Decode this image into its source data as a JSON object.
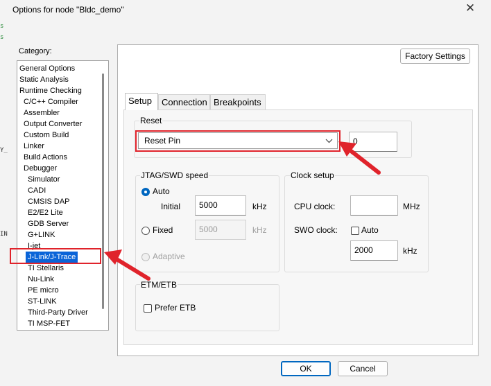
{
  "window": {
    "title": "Options for node \"Bldc_demo\"",
    "close_glyph": "✕"
  },
  "category": {
    "label": "Category:",
    "items": [
      {
        "label": "General Options"
      },
      {
        "label": "Static Analysis"
      },
      {
        "label": "Runtime Checking"
      },
      {
        "label": "C/C++ Compiler"
      },
      {
        "label": "Assembler"
      },
      {
        "label": "Output Converter"
      },
      {
        "label": "Custom Build"
      },
      {
        "label": "Linker"
      },
      {
        "label": "Build Actions"
      },
      {
        "label": "Debugger"
      },
      {
        "label": "Simulator"
      },
      {
        "label": "CADI"
      },
      {
        "label": "CMSIS DAP"
      },
      {
        "label": "E2/E2 Lite"
      },
      {
        "label": "GDB Server"
      },
      {
        "label": "G+LINK"
      },
      {
        "label": "I-jet"
      },
      {
        "label": "J-Link/J-Trace",
        "selected": true
      },
      {
        "label": "TI Stellaris"
      },
      {
        "label": "Nu-Link"
      },
      {
        "label": "PE micro"
      },
      {
        "label": "ST-LINK"
      },
      {
        "label": "Third-Party Driver"
      },
      {
        "label": "TI MSP-FET"
      }
    ]
  },
  "factory_settings_label": "Factory Settings",
  "tabs": [
    {
      "label": "Setup",
      "active": true
    },
    {
      "label": "Connection"
    },
    {
      "label": "Breakpoints"
    }
  ],
  "reset": {
    "group_label": "Reset",
    "selected": "Reset Pin",
    "delay_value": "0"
  },
  "jtag": {
    "group_label": "JTAG/SWD speed",
    "auto_label": "Auto",
    "initial_label": "Initial",
    "initial_value": "5000",
    "initial_unit": "kHz",
    "fixed_label": "Fixed",
    "fixed_value": "5000",
    "fixed_unit": "kHz",
    "adaptive_label": "Adaptive"
  },
  "clock": {
    "group_label": "Clock setup",
    "cpu_label": "CPU clock:",
    "cpu_value": "",
    "cpu_unit": "MHz",
    "swo_label": "SWO clock:",
    "swo_auto_label": "Auto",
    "swo_value": "2000",
    "swo_unit": "kHz"
  },
  "etm": {
    "group_label": "ETM/ETB",
    "prefer_label": "Prefer ETB"
  },
  "buttons": {
    "ok": "OK",
    "cancel": "Cancel"
  },
  "background_fragments": [
    "s",
    "s",
    "Y_",
    "IN"
  ],
  "colors": {
    "highlight_box": "#e0232b",
    "selection": "#0a64d8",
    "accent": "#0067c0"
  }
}
